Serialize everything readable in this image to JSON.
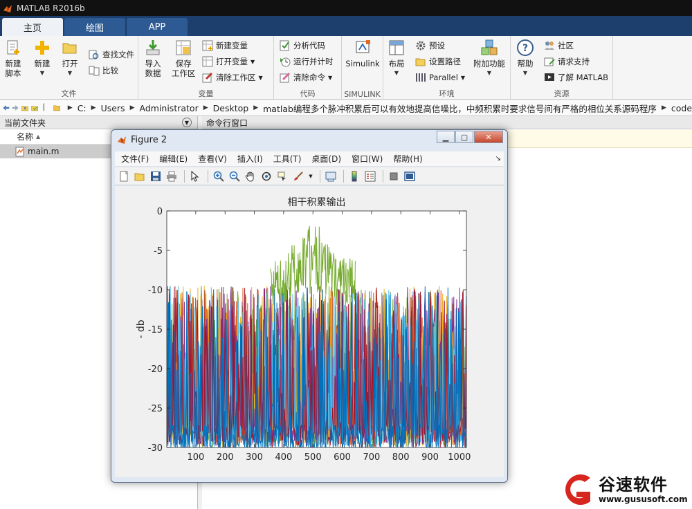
{
  "app": {
    "title": "MATLAB R2016b"
  },
  "tabs": [
    {
      "label": "主页",
      "active": true
    },
    {
      "label": "绘图",
      "active": false
    },
    {
      "label": "APP",
      "active": false
    }
  ],
  "ribbon": {
    "file": {
      "label": "文件",
      "new_script": "新建\n脚本",
      "new": "新建",
      "open": "打开",
      "find_files": "查找文件",
      "compare": "比较"
    },
    "variable": {
      "label": "变量",
      "import": "导入\n数据",
      "save_ws": "保存\n工作区",
      "new_var": "新建变量",
      "open_var": "打开变量",
      "clear_ws": "清除工作区"
    },
    "code": {
      "label": "代码",
      "analyze": "分析代码",
      "run_time": "运行并计时",
      "clear_cmd": "清除命令"
    },
    "simulink": {
      "label": "SIMULINK",
      "simulink": "Simulink"
    },
    "env": {
      "label": "环境",
      "layout": "布局",
      "prefs": "预设",
      "set_path": "设置路径",
      "parallel": "Parallel",
      "addons": "附加功能"
    },
    "resources": {
      "label": "资源",
      "help": "帮助",
      "community": "社区",
      "support": "请求支持",
      "learn": "了解 MATLAB"
    }
  },
  "address": {
    "crumbs": [
      "C:",
      "Users",
      "Administrator",
      "Desktop",
      "matlab编程多个脉冲积累后可以有效地提高信噪比，中频积累时要求信号间有严格的相位关系源码程序",
      "code"
    ]
  },
  "left_panel": {
    "title": "当前文件夹",
    "col_name": "名称",
    "files": [
      "main.m"
    ]
  },
  "cmd_panel": {
    "title": "命令行窗口"
  },
  "figure": {
    "title": "Figure 2",
    "menus": [
      "文件(F)",
      "编辑(E)",
      "查看(V)",
      "插入(I)",
      "工具(T)",
      "桌面(D)",
      "窗口(W)",
      "帮助(H)"
    ]
  },
  "chart_data": {
    "type": "line",
    "title": "相干积累输出",
    "xlabel": "",
    "ylabel": "- db",
    "xlim": [
      1,
      1024
    ],
    "ylim": [
      -30,
      0
    ],
    "xticks": [
      100,
      200,
      300,
      400,
      500,
      600,
      700,
      800,
      900,
      1000
    ],
    "yticks": [
      0,
      -5,
      -10,
      -15,
      -20,
      -25,
      -30
    ],
    "grid": false,
    "series_colors": [
      "#0072BD",
      "#D95319",
      "#EDB120",
      "#7E2F8E",
      "#77AC30",
      "#4DBEEE",
      "#A2142F"
    ],
    "description_values": {
      "noise_floor_db": [
        -30,
        -11
      ],
      "peak_series_color": "#77AC30",
      "peak_x_range": [
        355,
        645
      ],
      "peak_db": 0
    }
  },
  "watermark": {
    "name": "谷速软件",
    "url": "www.gususoft.com",
    "color": "#d7261e"
  }
}
